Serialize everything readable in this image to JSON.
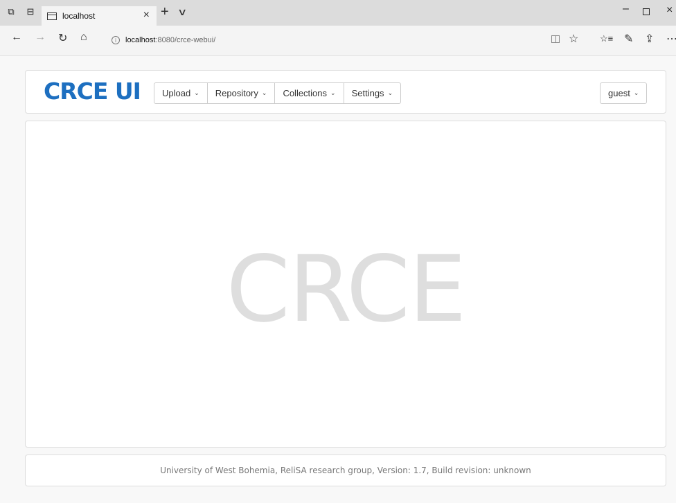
{
  "browser": {
    "tab_title": "localhost",
    "tab_close": "×",
    "new_tab": "+",
    "tab_dropdown": "∨",
    "url_host": "localhost",
    "url_rest": ":8080/crce-webui/",
    "window": {
      "minimize": "–",
      "close": "×"
    },
    "nav": {
      "back": "←",
      "forward": "→",
      "refresh": "↻",
      "home": "⌂"
    },
    "tools": {
      "favorite": "☆",
      "favorites_list": "☆≡",
      "pen": "✎",
      "share": "⇪",
      "more": "⋯"
    }
  },
  "app": {
    "brand": "CRCE UI",
    "menu": [
      {
        "label": "Upload"
      },
      {
        "label": "Repository"
      },
      {
        "label": "Collections"
      },
      {
        "label": "Settings"
      }
    ],
    "caret": "⌄",
    "user": "guest",
    "hero_text": "CRCE",
    "footer": "University of West Bohemia, ReliSA research group, Version: 1.7, Build revision: unknown",
    "colors": {
      "brand": "#1d6fc0",
      "hero": "#dedede"
    }
  }
}
